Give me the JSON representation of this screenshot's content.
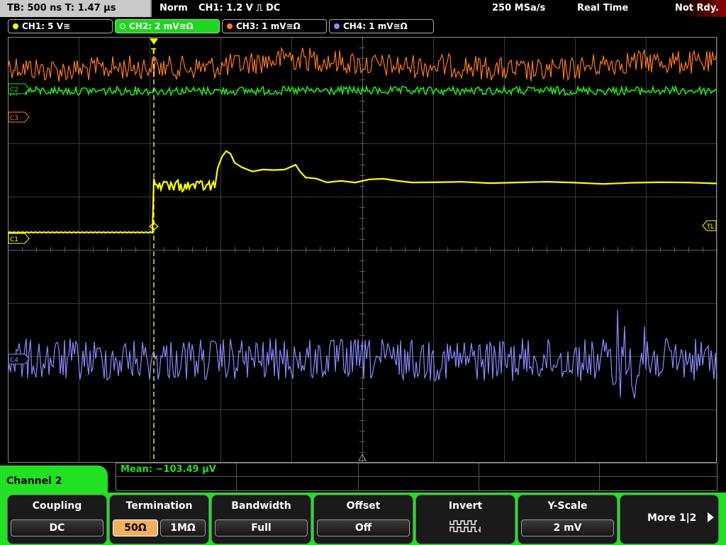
{
  "topbar": {
    "timebase": "TB: 500 ns   T: 1.47 µs",
    "trigger_mode": "Norm",
    "trigger_source": "CH1: 1.2 V ⎍ DC",
    "sample_rate": "250 MSa/s",
    "acquisition": "Real Time",
    "status": "Not Rdy."
  },
  "channels": [
    {
      "id": "ch1",
      "label": "CH1: 5 V≅",
      "color": "#ffff00"
    },
    {
      "id": "ch2",
      "label": "CH2: 2 mV≅Ω",
      "color": "#22e022"
    },
    {
      "id": "ch3",
      "label": "CH3: 1 mV≅Ω",
      "color": "#ff7a20"
    },
    {
      "id": "ch4",
      "label": "CH4: 1 mV≅Ω",
      "color": "#8a8aff"
    }
  ],
  "markers": {
    "c1": "C1",
    "c2": "C2",
    "c3": "C3",
    "c4": "C4",
    "tl": "TL",
    "trigger": "T"
  },
  "measurement": {
    "text": "Mean: −103.49 µV"
  },
  "menu": {
    "title": "Channel 2",
    "coupling": {
      "label": "Coupling",
      "value": "DC"
    },
    "termination": {
      "label": "Termination",
      "opt1": "50Ω",
      "opt2": "1MΩ"
    },
    "bandwidth": {
      "label": "Bandwidth",
      "value": "Full"
    },
    "offset": {
      "label": "Offset",
      "value": "Off"
    },
    "invert": {
      "label": "Invert",
      "icon": "inverted-square-wave-icon"
    },
    "yscale": {
      "label": "Y-Scale",
      "value": "2 mV"
    },
    "more": {
      "label": "More 1|2"
    }
  },
  "icons": {
    "trigger": "trigger-marker-icon",
    "more": "arrow-right-icon",
    "invert": "inverted-square-wave-icon"
  }
}
